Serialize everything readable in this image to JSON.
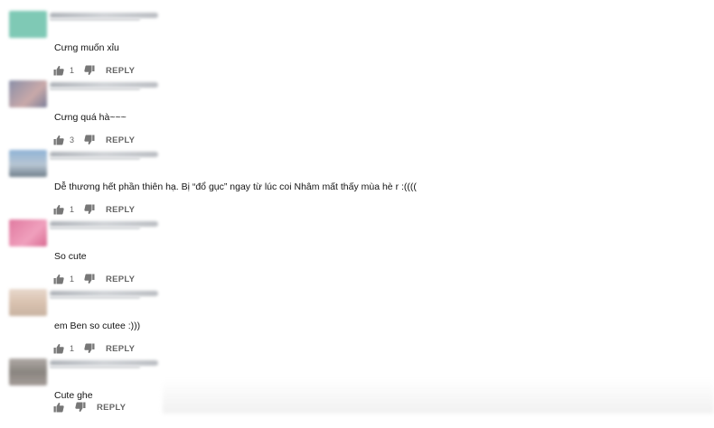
{
  "comments": [
    {
      "text": "Cưng muốn xỉu",
      "likes": "1",
      "reply_label": "REPLY",
      "avatar_color": "#7fc9b5"
    },
    {
      "text": "Cưng quá hà~~~",
      "likes": "3",
      "reply_label": "REPLY",
      "avatar_color": "#8a8fa8"
    },
    {
      "text": "Dễ thương hết phần thiên hạ. Bị “đổ gục” ngay từ lúc coi Nhâm mất thấy mùa hè r :((((",
      "likes": "1",
      "reply_label": "REPLY",
      "avatar_color": "#8fb3d6"
    },
    {
      "text": "So cute",
      "likes": "1",
      "reply_label": "REPLY",
      "avatar_color": "#e07aa0"
    },
    {
      "text": "em Ben so cutee :)))",
      "likes": "1",
      "reply_label": "REPLY",
      "avatar_color": "#d9c2b0"
    },
    {
      "text": "Cute ghe",
      "likes": "",
      "reply_label": "REPLY",
      "avatar_color": "#9a9a9a"
    }
  ],
  "icons": {
    "like": "thumbs-up-icon",
    "dislike": "thumbs-down-icon"
  }
}
